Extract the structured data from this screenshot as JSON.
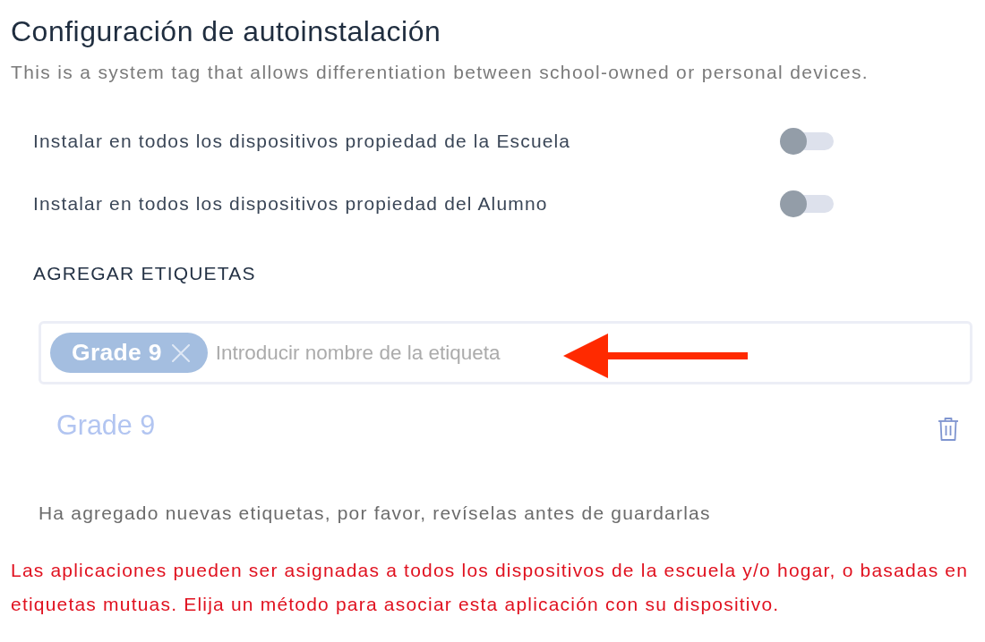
{
  "section": {
    "title": "Configuración de autoinstalación",
    "description": "This is a system tag that allows differentiation between school-owned or personal devices."
  },
  "toggles": [
    {
      "label": "Instalar en todos los dispositivos propiedad de la Escuela",
      "on": false
    },
    {
      "label": "Instalar en todos los dispositivos propiedad del Alumno",
      "on": false
    }
  ],
  "tags_heading": "AGREGAR ETIQUETAS",
  "tag_input": {
    "chips": [
      {
        "label": "Grade 9"
      }
    ],
    "placeholder": "Introducir nombre de la etiqueta"
  },
  "tag_list": [
    {
      "label": "Grade 9"
    }
  ],
  "notice": "Ha agregado nuevas etiquetas, por favor, revíselas antes de guardarlas",
  "error": "Las aplicaciones pueden ser asignadas a todos los dispositivos de la escuela y/o hogar, o basadas en etiquetas mutuas. Elija un método para asociar esta aplicación con su dispositivo."
}
